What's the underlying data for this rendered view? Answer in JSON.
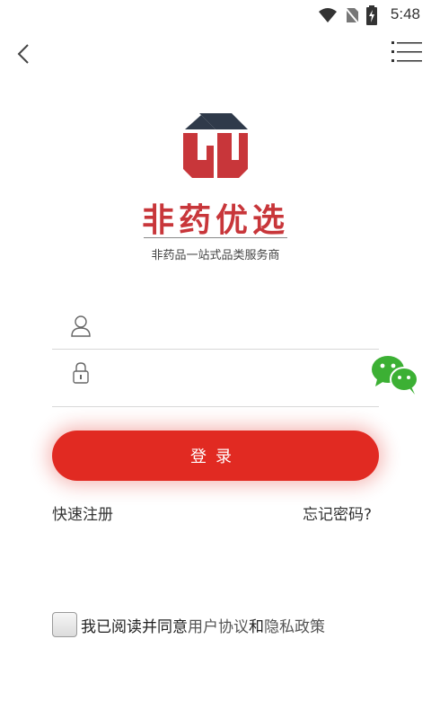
{
  "status_bar": {
    "time": "5:48"
  },
  "brand": {
    "name": "非药优选",
    "tagline": "非药品一站式品类服务商",
    "colors": {
      "primary": "#c8363a",
      "secondary": "#2f3a4a"
    }
  },
  "form": {
    "username_placeholder": "",
    "password_placeholder": "",
    "login_label": "登录"
  },
  "links": {
    "register": "快速注册",
    "forgot": "忘记密码?"
  },
  "agreement": {
    "prefix": "我已阅读并同意",
    "user_agreement": "用户协议",
    "and": "和",
    "privacy_policy": "隐私政策",
    "checked": false
  },
  "colors": {
    "accent": "#e12a22",
    "wechat": "#3cb034"
  }
}
